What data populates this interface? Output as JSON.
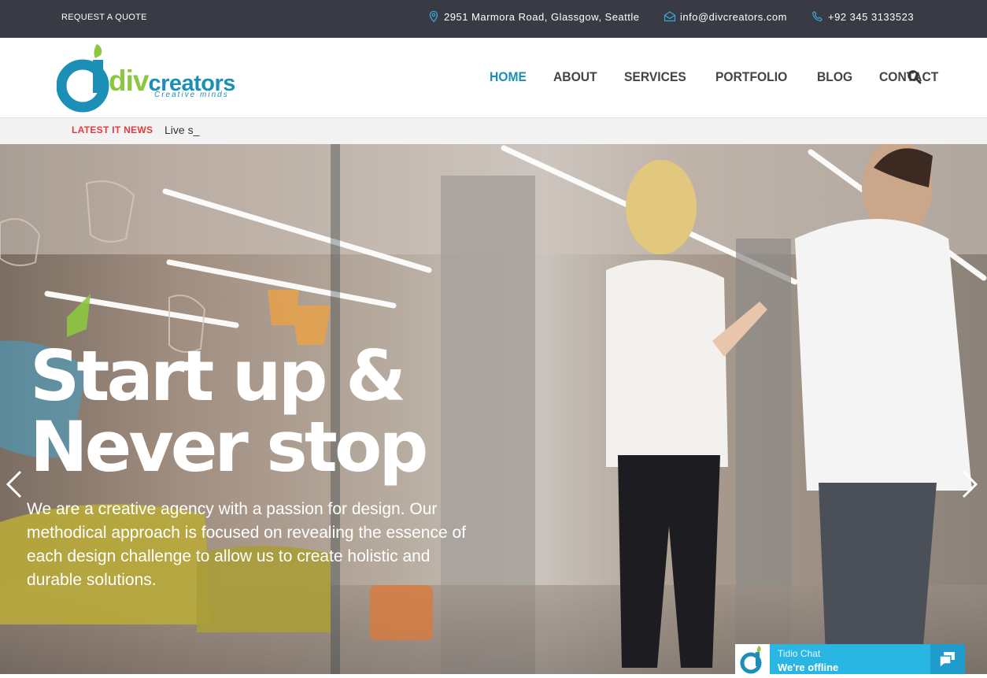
{
  "topbar": {
    "quote_label": "REQUEST A QUOTE",
    "address": "2951 Marmora Road, Glassgow, Seattle",
    "email": "info@divcreators.com",
    "phone": "+92 345 3133523",
    "icons": [
      "map-pin-icon",
      "envelope-icon",
      "phone-icon"
    ]
  },
  "logo": {
    "prefix": "div",
    "name": "creators",
    "tagline": "Creative minds"
  },
  "nav": {
    "items": [
      {
        "label": "HOME",
        "active": true
      },
      {
        "label": "ABOUT",
        "active": false
      },
      {
        "label": "SERVICES",
        "active": false
      },
      {
        "label": "PORTFOLIO",
        "active": false
      },
      {
        "label": "BLOG",
        "active": false
      },
      {
        "label": "CONTACT",
        "active": false
      }
    ],
    "search_icon": "search-icon"
  },
  "ticker": {
    "label": "LATEST IT NEWS",
    "text": "Live s_"
  },
  "hero": {
    "title_line1": "Start up &",
    "title_line2": "Never stop",
    "description": "We are a creative agency with a passion for design. Our methodical approach is focused on revealing the essence of each design challenge to allow us to create holistic and durable solutions."
  },
  "chat": {
    "title": "Tidio Chat",
    "status": "We're offline"
  },
  "colors": {
    "topbar_bg": "#383b44",
    "brand_blue": "#1c8fb7",
    "brand_green": "#8dc63f",
    "news_red": "#e33b3b",
    "chat_blue": "#29b6e2"
  }
}
